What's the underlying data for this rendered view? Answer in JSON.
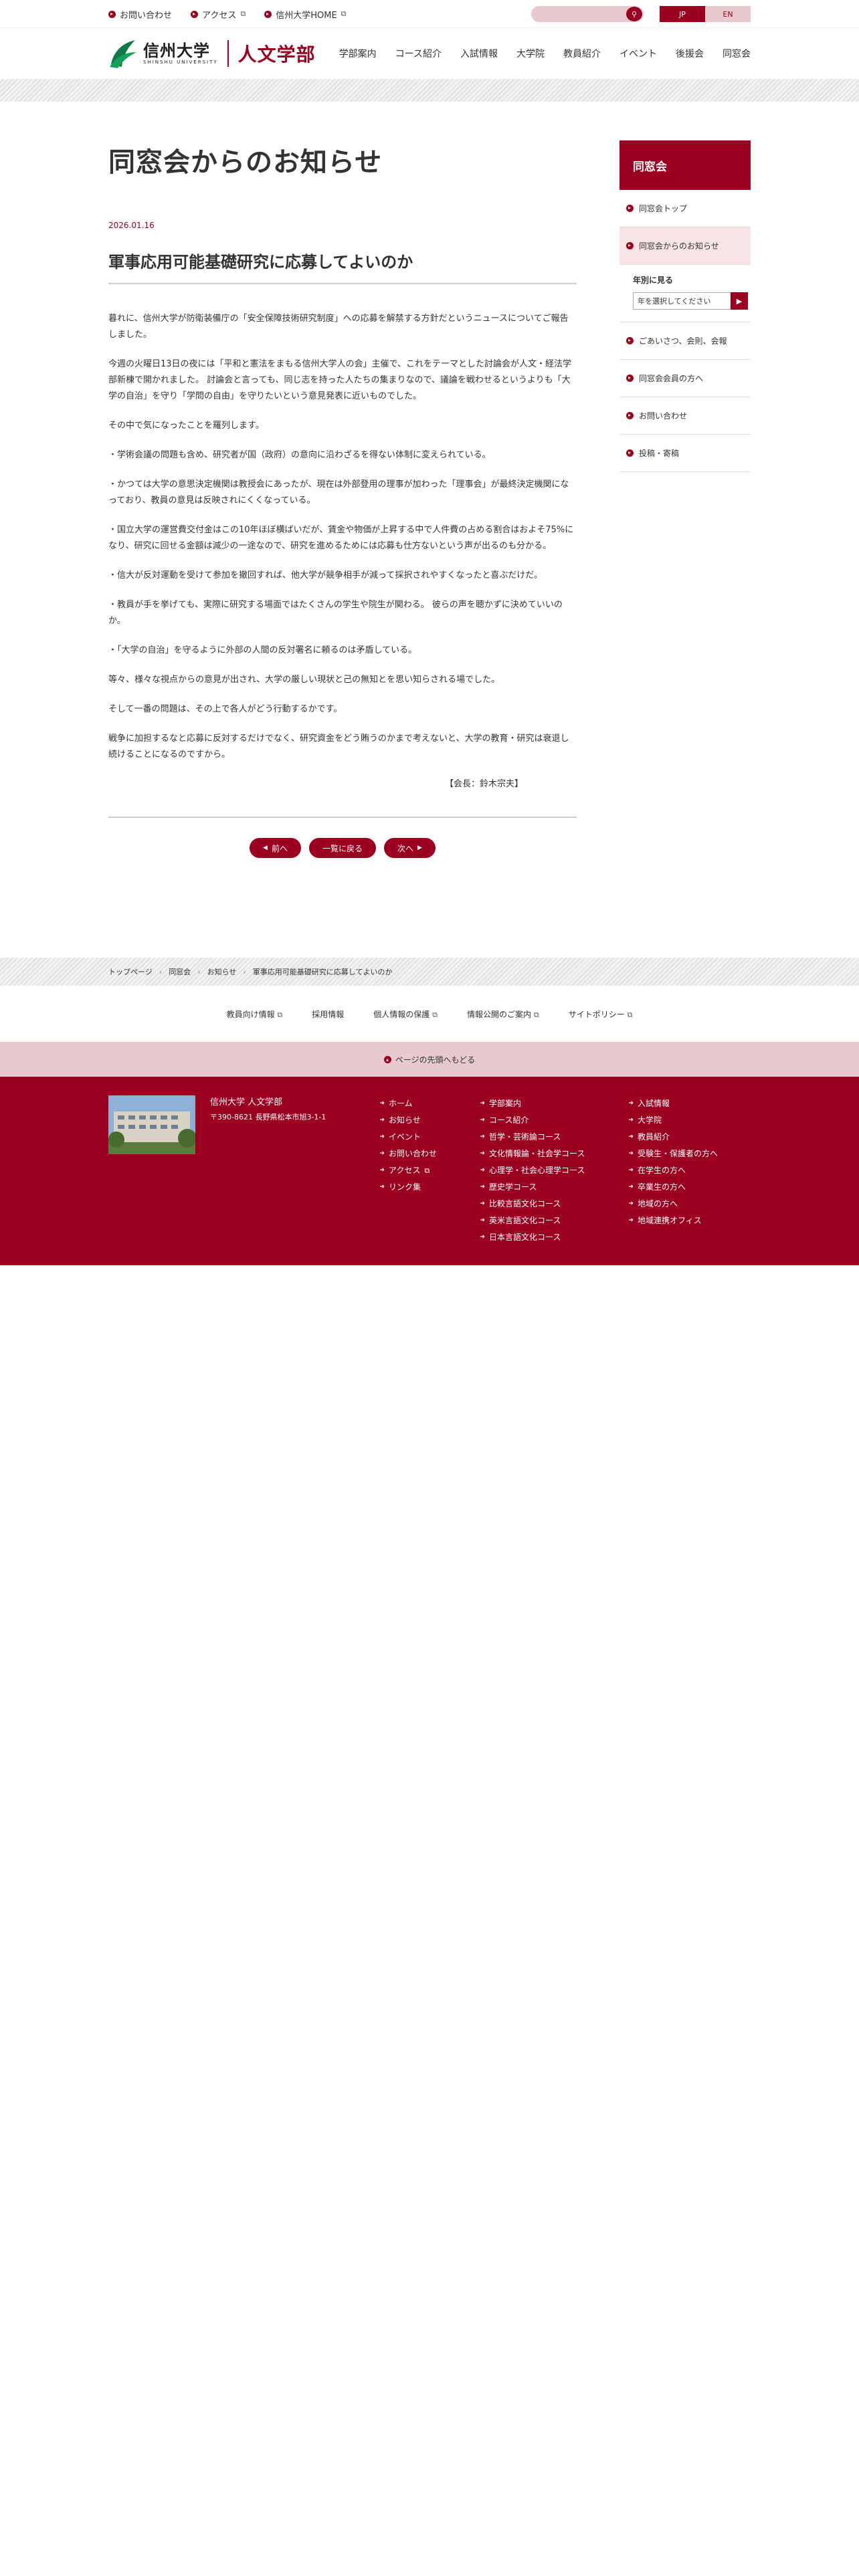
{
  "util": {
    "links": [
      "お問い合わせ",
      "アクセス",
      "信州大学HOME"
    ],
    "lang_jp": "JP",
    "lang_en": "EN"
  },
  "logo": {
    "univ_jp": "信州大学",
    "univ_en": "SHINSHU UNIVERSITY",
    "dept": "人文学部"
  },
  "gnav": [
    "学部案内",
    "コース紹介",
    "入試情報",
    "大学院",
    "教員紹介",
    "イベント",
    "後援会",
    "同窓会"
  ],
  "article": {
    "page_title": "同窓会からのお知らせ",
    "date": "2026.01.16",
    "title": "軍事応用可能基礎研究に応募してよいのか",
    "paragraphs": [
      "暮れに、信州大学が防衛装備庁の「安全保障技術研究制度」への応募を解禁する方針だというニュースについてご報告しました。",
      "今週の火曜日13日の夜には「平和と憲法をまもる信州大学人の会」主催で、これをテーマとした討論会が人文・経法学部新棟で開かれました。 討論会と言っても、同じ志を持った人たちの集まりなので、議論を戦わせるというよりも「大学の自治」を守り「学問の自由」を守りたいという意見発表に近いものでした。",
      "その中で気になったことを羅列します。",
      "・学術会議の問題も含め、研究者が国（政府）の意向に沿わざるを得ない体制に変えられている。",
      "・かつては大学の意思決定機関は教授会にあったが、現在は外部登用の理事が加わった「理事会」が最終決定機関になっており、教員の意見は反映されにくくなっている。",
      "・国立大学の運営費交付金はこの10年ほぼ横ばいだが、賃金や物価が上昇する中で人件費の占める割合はおよそ75%になり、研究に回せる金額は減少の一途なので、研究を進めるためには応募も仕方ないという声が出るのも分かる。",
      "・信大が反対運動を受けて参加を撤回すれば、他大学が競争相手が減って採択されやすくなったと喜ぶだけだ。",
      "・教員が手を挙げても、実際に研究する場面ではたくさんの学生や院生が関わる。 彼らの声を聴かずに決めていいのか。",
      "・「大学の自治」を守るように外部の人間の反対署名に頼るのは矛盾している。",
      "等々、様々な視点からの意見が出され、大学の厳しい現状と己の無知とを思い知らされる場でした。",
      "そして一番の問題は、その上で各人がどう行動するかです。",
      "戦争に加担するなと応募に反対するだけでなく、研究資金をどう賄うのかまで考えないと、大学の教育・研究は衰退し続けることになるのですから。"
    ],
    "signature": "【会長：鈴木宗夫】",
    "prev": "前へ",
    "list": "一覧に戻る",
    "next": "次へ"
  },
  "side": {
    "head": "同窓会",
    "items": [
      "同窓会トップ",
      "同窓会からのお知らせ"
    ],
    "year_label": "年別に見る",
    "year_select": "年を選択してください",
    "items2": [
      "ごあいさつ、会則、会報",
      "同窓会会員の方へ",
      "お問い合わせ",
      "投稿・寄稿"
    ]
  },
  "breadcrumb": [
    "トップページ",
    "同窓会",
    "お知らせ",
    "軍事応用可能基礎研究に応募してよいのか"
  ],
  "sublinks": [
    "教員向け情報",
    "採用情報",
    "個人情報の保護",
    "情報公開のご案内",
    "サイトポリシー"
  ],
  "totop": "ページの先頭へもどる",
  "footer": {
    "name": "信州大学 人文学部",
    "address": "〒390-8621 長野県松本市旭3-1-1",
    "col1": [
      "ホーム",
      "お知らせ",
      "イベント",
      "お問い合わせ",
      "アクセス",
      "リンク集"
    ],
    "col2": [
      "学部案内",
      "コース紹介",
      "哲学・芸術論コース",
      "文化情報論・社会学コース",
      "心理学・社会心理学コース",
      "歴史学コース",
      "比較言語文化コース",
      "英米言語文化コース",
      "日本言語文化コース"
    ],
    "col3": [
      "入試情報",
      "大学院",
      "教員紹介",
      "受験生・保護者の方へ",
      "在学生の方へ",
      "卒業生の方へ",
      "地域の方へ",
      "地域連携オフィス"
    ]
  },
  "colors": {
    "accent": "#9b0020",
    "accent_light": "#e8c9ce",
    "active_bg": "#f8e4e7"
  }
}
